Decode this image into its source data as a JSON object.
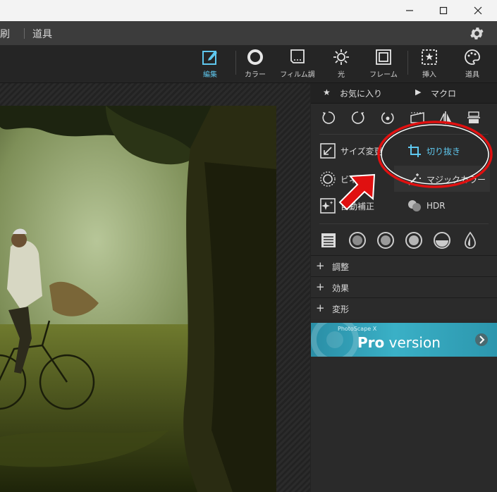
{
  "window": {
    "minimize_icon": "minimize-icon",
    "maximize_icon": "maximize-icon",
    "close_icon": "close-icon"
  },
  "menubar": {
    "items": [
      "印刷",
      "道具"
    ],
    "gear_icon": "gear-icon"
  },
  "toolbar": {
    "tools": [
      {
        "label": "編集",
        "icon": "edit-icon",
        "active": true
      },
      {
        "label": "カラー",
        "icon": "color-icon"
      },
      {
        "label": "フィルム調",
        "icon": "film-icon"
      },
      {
        "label": "光",
        "icon": "light-icon"
      },
      {
        "label": "フレーム",
        "icon": "frame-icon"
      },
      {
        "label": "挿入",
        "icon": "insert-icon"
      },
      {
        "label": "道具",
        "icon": "tools-icon"
      }
    ],
    "active_color": "#5fc8ef"
  },
  "panel": {
    "favorites_label": "お気に入り",
    "macro_label": "マクロ",
    "rotate_icons": [
      "rotate-left-icon",
      "rotate-right-icon",
      "straighten-icon",
      "perspective-icon",
      "flip-horizontal-icon",
      "flip-vertical-icon"
    ],
    "features": {
      "resize": "サイズ変更",
      "crop": "切り抜き",
      "vignette": "ビネット",
      "magic_color": "マジックカラー",
      "auto": "自動補正",
      "hdr": "HDR"
    },
    "filter_icons": [
      "levels-icon",
      "circle-filter-icon",
      "circle-filter-icon",
      "circle-filter-icon",
      "half-circle-icon",
      "drop-icon"
    ],
    "sections": [
      "調整",
      "効果",
      "変形"
    ],
    "promo": {
      "small_text": "PhotoScape X",
      "pro": "Pro",
      "version": " version",
      "arrow_icon": "arrow-right-icon"
    }
  },
  "annotation": {
    "highlight_color": "#e01010",
    "arrow_color": "#e01010"
  }
}
